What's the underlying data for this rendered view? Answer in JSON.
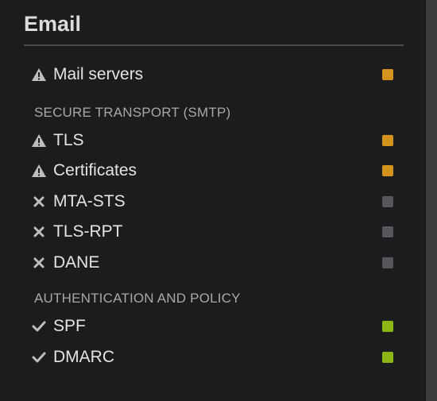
{
  "panel": {
    "title": "Email"
  },
  "top_items": [
    {
      "label": "Mail servers",
      "icon": "warning-icon",
      "status": "warning",
      "status_color": "#d4931c"
    }
  ],
  "sections": [
    {
      "heading": "SECURE TRANSPORT (SMTP)",
      "items": [
        {
          "label": "TLS",
          "icon": "warning-icon",
          "status": "warning",
          "status_color": "#d4931c"
        },
        {
          "label": "Certificates",
          "icon": "warning-icon",
          "status": "warning",
          "status_color": "#d4931c"
        },
        {
          "label": "MTA-STS",
          "icon": "cross-icon",
          "status": "not-configured",
          "status_color": "#55575a"
        },
        {
          "label": "TLS-RPT",
          "icon": "cross-icon",
          "status": "not-configured",
          "status_color": "#55575a"
        },
        {
          "label": "DANE",
          "icon": "cross-icon",
          "status": "not-configured",
          "status_color": "#55575a"
        }
      ]
    },
    {
      "heading": "AUTHENTICATION AND POLICY",
      "items": [
        {
          "label": "SPF",
          "icon": "check-icon",
          "status": "ok",
          "status_color": "#8db614"
        },
        {
          "label": "DMARC",
          "icon": "check-icon",
          "status": "ok",
          "status_color": "#8db614"
        }
      ]
    }
  ],
  "colors": {
    "background": "#1b1c1e",
    "warning": "#d4931c",
    "neutral": "#55575a",
    "ok": "#8db614"
  }
}
